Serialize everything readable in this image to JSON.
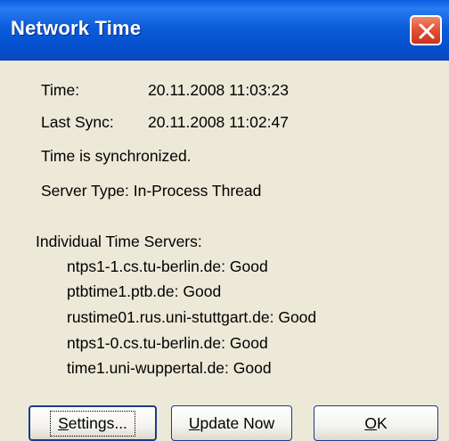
{
  "window": {
    "title": "Network Time",
    "close_icon": "close-icon"
  },
  "info": {
    "time_label": "Time:",
    "time_value": "20.11.2008 11:03:23",
    "last_sync_label": "Last Sync:",
    "last_sync_value": "20.11.2008 11:02:47",
    "status": "Time is synchronized.",
    "server_type": "Server Type: In-Process Thread"
  },
  "servers": {
    "header": "Individual Time Servers:",
    "items": [
      "ntps1-1.cs.tu-berlin.de: Good",
      "ptbtime1.ptb.de: Good",
      "rustime01.rus.uni-stuttgart.de: Good",
      "ntps1-0.cs.tu-berlin.de: Good",
      "time1.uni-wuppertal.de: Good"
    ]
  },
  "buttons": {
    "settings_mnemonic": "S",
    "settings_rest": "ettings...",
    "update_mnemonic": "U",
    "update_rest": "pdate Now",
    "ok_mnemonic": "O",
    "ok_rest": "K"
  }
}
